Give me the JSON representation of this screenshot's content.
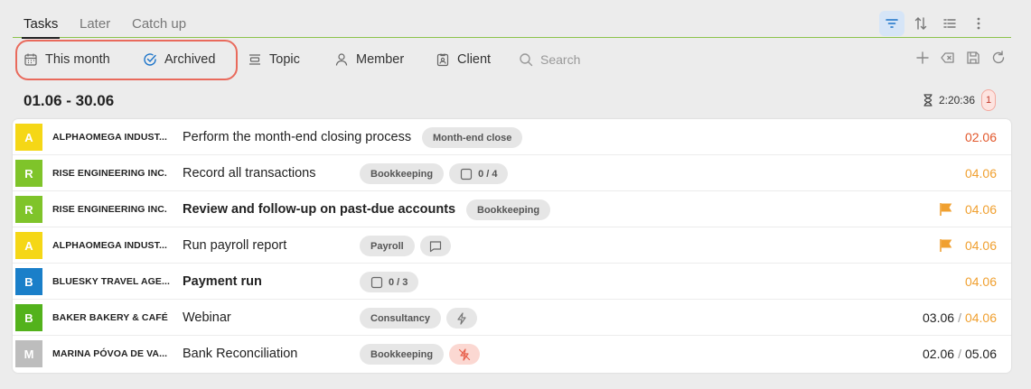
{
  "tabs": [
    {
      "label": "Tasks",
      "active": true
    },
    {
      "label": "Later",
      "active": false
    },
    {
      "label": "Catch up",
      "active": false
    }
  ],
  "toolbar_icons": [
    "filter-icon",
    "sort-icon",
    "list-view-icon",
    "more-icon"
  ],
  "filters": {
    "this_month": "This month",
    "archived": "Archived",
    "topic": "Topic",
    "member": "Member",
    "client": "Client",
    "search_placeholder": "Search"
  },
  "filter_actions": [
    "add-icon",
    "clear-icon",
    "save-icon",
    "refresh-icon"
  ],
  "group": {
    "date_range": "01.06 - 30.06",
    "timer": "2:20:36",
    "count": "1"
  },
  "colors": {
    "accent": "#1a73c9",
    "overdue": "#e2572b",
    "upcoming": "#f0a030",
    "highlight": "#e96a5c"
  },
  "tasks": [
    {
      "avatar": "A",
      "avatar_color": "#f5d716",
      "client": "ALPHAOMEGA INDUST...",
      "title": "Perform the month-end closing process",
      "bold": false,
      "tags": [
        {
          "label": "Month-end close"
        }
      ],
      "due_start": "",
      "due": "02.06",
      "due_color": "#e2572b",
      "flag": false
    },
    {
      "avatar": "R",
      "avatar_color": "#7fc42a",
      "client": "RISE ENGINEERING INC.",
      "title": "Record all transactions",
      "bold": false,
      "tags": [
        {
          "label": "Bookkeeping"
        },
        {
          "label": "0 / 4",
          "icon": "checkbox-icon"
        }
      ],
      "due_start": "",
      "due": "04.06",
      "due_color": "#f0a030",
      "flag": false
    },
    {
      "avatar": "R",
      "avatar_color": "#7fc42a",
      "client": "RISE ENGINEERING INC.",
      "title": "Review and follow-up on past-due accounts",
      "bold": true,
      "tags": [
        {
          "label": "Bookkeeping"
        }
      ],
      "due_start": "",
      "due": "04.06",
      "due_color": "#f0a030",
      "flag": true
    },
    {
      "avatar": "A",
      "avatar_color": "#f5d716",
      "client": "ALPHAOMEGA INDUST...",
      "title": "Run payroll report",
      "bold": false,
      "tags": [
        {
          "label": "Payroll"
        },
        {
          "label": "",
          "icon": "comment-icon"
        }
      ],
      "due_start": "",
      "due": "04.06",
      "due_color": "#f0a030",
      "flag": true
    },
    {
      "avatar": "B",
      "avatar_color": "#1a7fc9",
      "client": "BLUESKY TRAVEL AGE...",
      "title": "Payment run",
      "bold": true,
      "tags": [
        {
          "label": "0 / 3",
          "icon": "checkbox-icon"
        }
      ],
      "due_start": "",
      "due": "04.06",
      "due_color": "#f0a030",
      "flag": false
    },
    {
      "avatar": "B",
      "avatar_color": "#53b21c",
      "client": "BAKER BAKERY & CAFÉ",
      "title": "Webinar",
      "bold": false,
      "tags": [
        {
          "label": "Consultancy"
        },
        {
          "label": "",
          "icon": "bolt-icon"
        }
      ],
      "due_start": "03.06",
      "due": "04.06",
      "due_color": "#f0a030",
      "flag": false
    },
    {
      "avatar": "M",
      "avatar_color": "#bdbdbd",
      "client": "MARINA PÓVOA DE VA...",
      "title": "Bank Reconciliation",
      "bold": false,
      "tags": [
        {
          "label": "Bookkeeping"
        },
        {
          "label": "",
          "icon": "bolt-off-icon",
          "danger": true
        }
      ],
      "due_start": "02.06",
      "due": "05.06",
      "due_color": "#222222",
      "flag": false
    }
  ]
}
